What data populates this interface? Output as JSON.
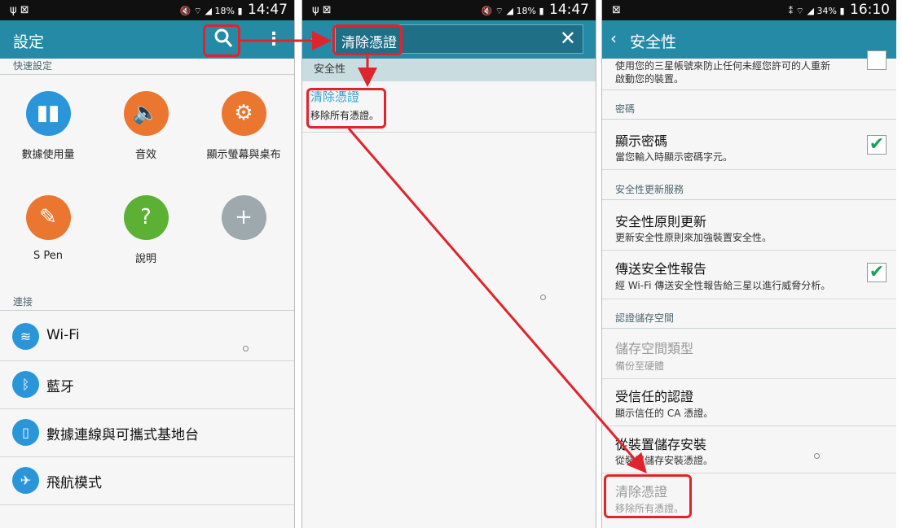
{
  "panel1": {
    "status": {
      "left_icons": "ψ ⊠",
      "battery": "18%",
      "time": "14:47"
    },
    "title": "設定",
    "quick_settings_header": "快速設定",
    "grid": [
      {
        "label": "數據使用量",
        "icon": "bar-chart-icon",
        "color": "#2a96d9",
        "glyph": "▮▮"
      },
      {
        "label": "音效",
        "icon": "speaker-icon",
        "color": "#ea7630",
        "glyph": "🔈"
      },
      {
        "label": "顯示螢幕與桌布",
        "icon": "display-gear-icon",
        "color": "#ea7630",
        "glyph": "⚙"
      },
      {
        "label": "S Pen",
        "icon": "pen-icon",
        "color": "#ea7630",
        "glyph": "✎"
      },
      {
        "label": "說明",
        "icon": "help-icon",
        "color": "#5cb135",
        "glyph": "?"
      },
      {
        "label": "",
        "icon": "add-icon",
        "color": "#9ea9ae",
        "glyph": "+"
      }
    ],
    "connections_header": "連接",
    "list": [
      {
        "label": "Wi-Fi",
        "icon": "wifi-icon",
        "glyph": "≋"
      },
      {
        "label": "藍牙",
        "icon": "bluetooth-icon",
        "glyph": "ᛒ"
      },
      {
        "label": "數據連線與可攜式基地台",
        "icon": "hotspot-icon",
        "glyph": "▯"
      },
      {
        "label": "飛航模式",
        "icon": "airplane-icon",
        "glyph": "✈"
      }
    ]
  },
  "panel2": {
    "status": {
      "left_icons": "ψ ⊠",
      "battery": "18%",
      "time": "14:47"
    },
    "search_value": "清除憑證",
    "result_category": "安全性",
    "result_title": "清除憑證",
    "result_subtitle": "移除所有憑證。"
  },
  "panel3": {
    "status": {
      "left_icons": "⊠",
      "battery": "34%",
      "time": "16:10"
    },
    "title": "安全性",
    "top_text_1": "使用您的三星帳號來防止任何未經您許可的人重新",
    "top_text_2": "啟動您的裝置。",
    "sec_password": "密碼",
    "show_password_title": "顯示密碼",
    "show_password_sub": "當您輸入時顯示密碼字元。",
    "sec_update": "安全性更新服務",
    "policy_title": "安全性原則更新",
    "policy_sub": "更新安全性原則來加強裝置安全性。",
    "report_title": "傳送安全性報告",
    "report_sub": "經 Wi-Fi 傳送安全性報告給三星以進行威脅分析。",
    "sec_storage": "認證儲存空間",
    "storage_type_title": "儲存空間類型",
    "storage_type_sub": "備份至硬體",
    "trusted_title": "受信任的認證",
    "trusted_sub": "顯示信任的 CA 憑證。",
    "install_title": "從裝置儲存安裝",
    "install_sub": "從裝置儲存安裝憑證。",
    "clear_title": "清除憑證",
    "clear_sub": "移除所有憑證。",
    "show_password_checked": true,
    "report_checked": true
  },
  "colors": {
    "appbar": "#258aa6",
    "highlight": "#e0242e",
    "check": "#1ba05a"
  }
}
